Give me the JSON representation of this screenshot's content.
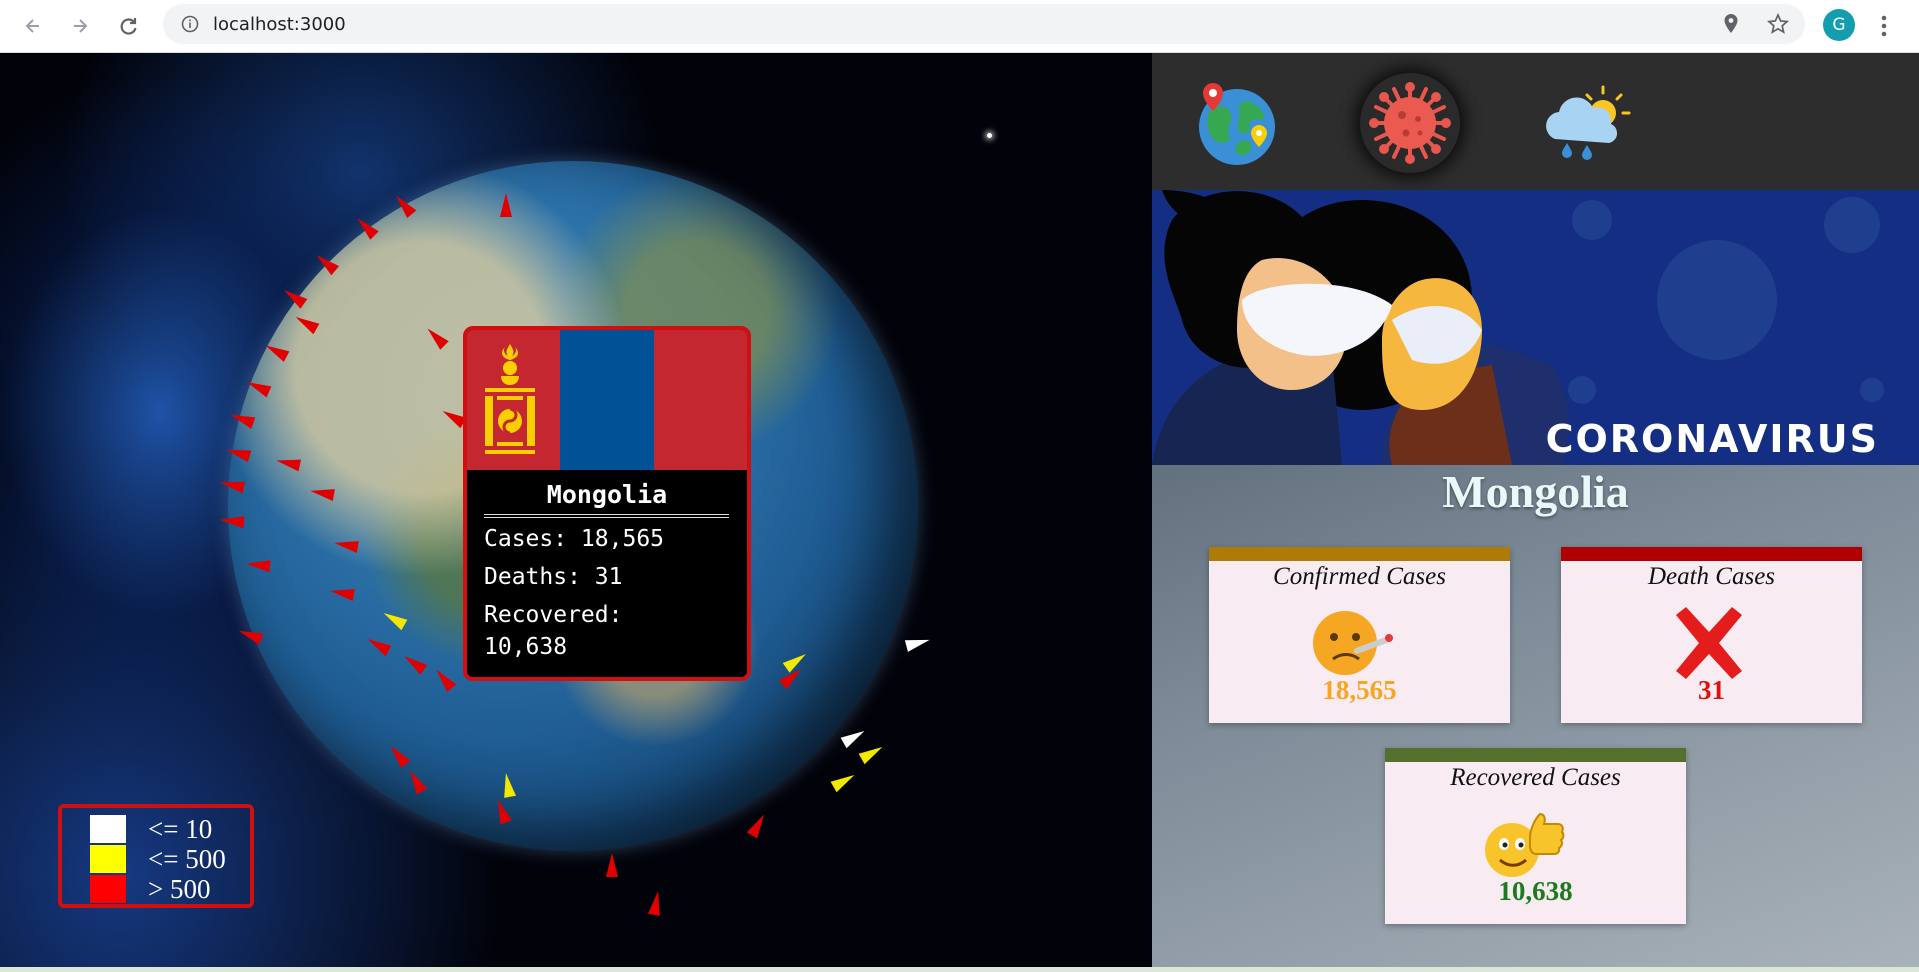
{
  "browser": {
    "url": "localhost:3000",
    "profile_initial": "G"
  },
  "tooltip": {
    "country": "Mongolia",
    "cases_line": "Cases: 18,565",
    "deaths_line": "Deaths: 31",
    "recovered_label": "Recovered:",
    "recovered_value": "10,638",
    "flag_colors": [
      "#c4272f",
      "#015197",
      "#c4272f"
    ],
    "emblem_color": "#f9cf02"
  },
  "legend": {
    "items": [
      {
        "label": "<= 10",
        "color": "#ffffff"
      },
      {
        "label": "<= 500",
        "color": "#ffff00"
      },
      {
        "label": "> 500",
        "color": "#ff0000"
      }
    ]
  },
  "panel": {
    "nav_icons": [
      "globe-map-icon",
      "virus-icon",
      "weather-icon"
    ],
    "active_nav": "virus-icon",
    "banner_title": "CORONAVIRUS",
    "country": "Mongolia",
    "cards": {
      "confirmed": {
        "title": "Confirmed Cases",
        "value": "18,565",
        "bar_color": "#b07a06",
        "value_color": "#f5a623",
        "icon": "sick-face-icon"
      },
      "deaths": {
        "title": "Death Cases",
        "value": "31",
        "bar_color": "#b00000",
        "value_color": "#e01010",
        "icon": "cross-mark-icon"
      },
      "recovered": {
        "title": "Recovered Cases",
        "value": "10,638",
        "bar_color": "#55702d",
        "value_color": "#1f7a1f",
        "icon": "thumbs-up-face-icon"
      }
    }
  }
}
